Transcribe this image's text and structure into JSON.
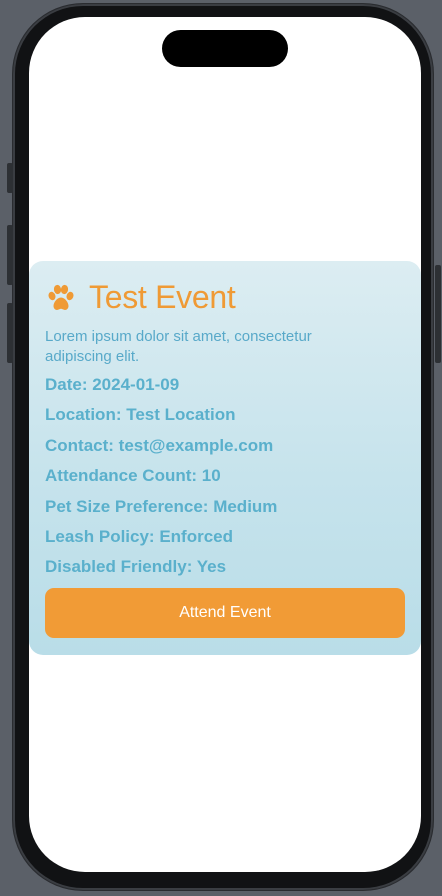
{
  "event": {
    "icon": "paw-icon",
    "title": "Test Event",
    "description": "Lorem ipsum dolor sit amet, consectetur adipiscing elit.",
    "details": [
      "Date: 2024-01-09",
      "Location: Test Location",
      "Contact: test@example.com",
      "Attendance Count: 10",
      "Pet Size Preference: Medium",
      "Leash Policy: Enforced",
      "Disabled Friendly: Yes"
    ],
    "attend_label": "Attend Event"
  },
  "colors": {
    "accent": "#f19b36",
    "title": "#ef9a35",
    "detail_text": "#5ab0cc",
    "card_top": "#dcedf2",
    "card_bottom": "#b9dde8"
  }
}
